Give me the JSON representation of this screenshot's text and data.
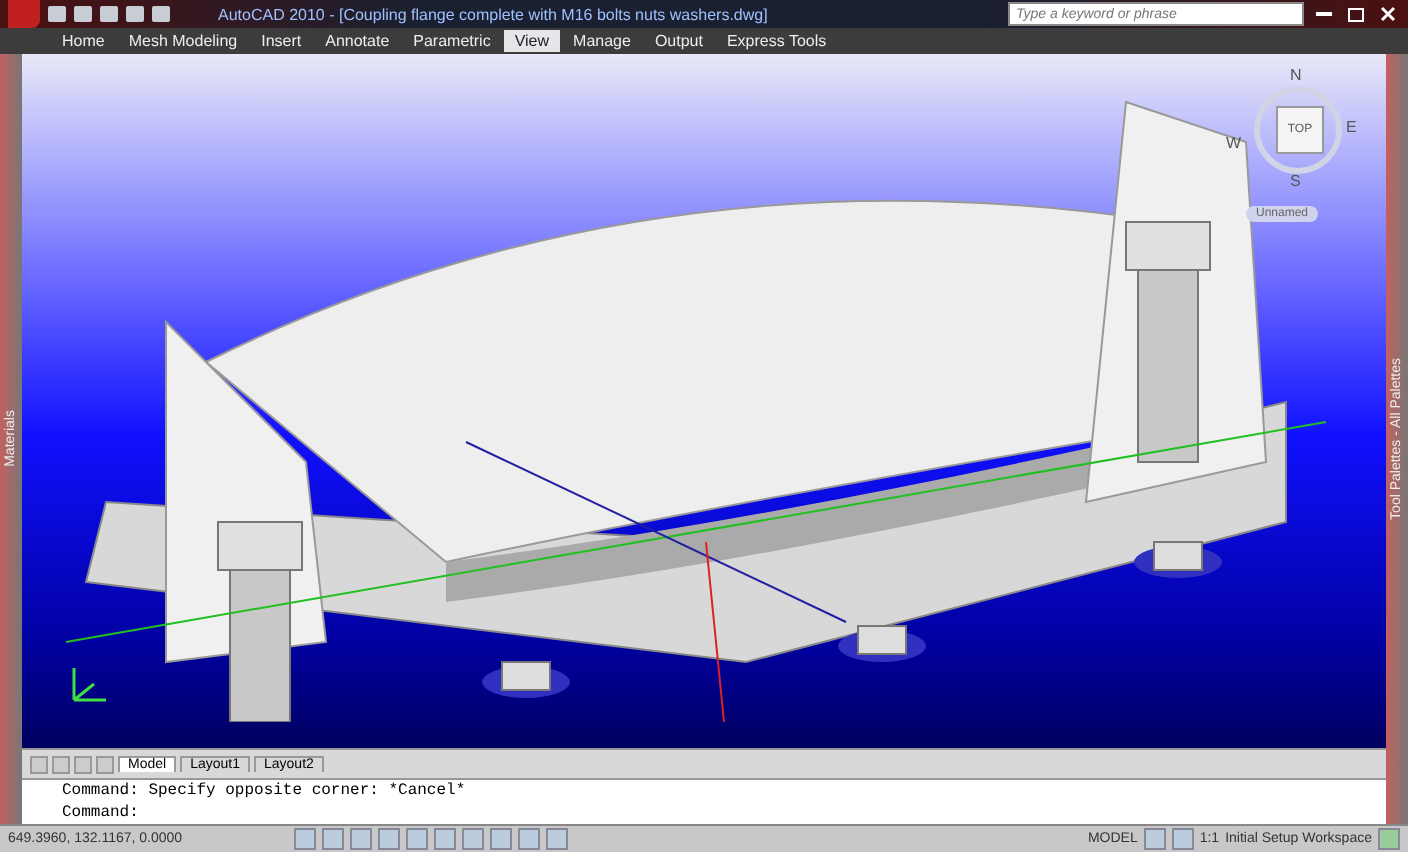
{
  "window": {
    "title": "AutoCAD 2010 - [Coupling flange complete with M16 bolts nuts washers.dwg]"
  },
  "search": {
    "placeholder": "Type a keyword or phrase"
  },
  "ribbon_tabs": [
    {
      "label": "Home",
      "selected": false
    },
    {
      "label": "Mesh Modeling",
      "selected": false
    },
    {
      "label": "Insert",
      "selected": false
    },
    {
      "label": "Annotate",
      "selected": false
    },
    {
      "label": "Parametric",
      "selected": false
    },
    {
      "label": "View",
      "selected": true
    },
    {
      "label": "Manage",
      "selected": false
    },
    {
      "label": "Output",
      "selected": false
    },
    {
      "label": "Express Tools",
      "selected": false
    }
  ],
  "left_palette": {
    "title": "Materials"
  },
  "right_palette": {
    "title": "Tool Palettes - All Palettes"
  },
  "viewcube": {
    "face": "TOP",
    "north": "N",
    "east": "E",
    "south": "S",
    "west": "W",
    "view_label": "Unnamed"
  },
  "layout_tabs": [
    {
      "label": "Model",
      "selected": true
    },
    {
      "label": "Layout1",
      "selected": false
    },
    {
      "label": "Layout2",
      "selected": false
    }
  ],
  "command_lines": [
    "Command: Specify opposite corner: *Cancel*",
    "Command:"
  ],
  "status_bar": {
    "coordinates": "649.3960, 132.1167, 0.0000",
    "space": "MODEL",
    "scale": "1:1",
    "workspace": "Initial Setup Workspace"
  }
}
